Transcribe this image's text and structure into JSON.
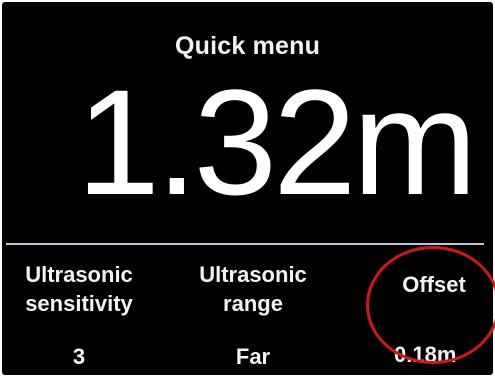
{
  "menu": {
    "title": "Quick menu",
    "reading": "1.32m"
  },
  "settings": [
    {
      "label_line1": "Ultrasonic",
      "label_line2": "sensitivity",
      "value": "3"
    },
    {
      "label_line1": "Ultrasonic",
      "label_line2": "range",
      "value": "Far"
    },
    {
      "label_line1": "Offset",
      "label_line2": "",
      "value": "0.18m"
    }
  ],
  "colors": {
    "screen_background": "#000000",
    "text": "#f2f2f2",
    "divider": "#bfc6dc",
    "highlight_ring": "#d01818"
  }
}
